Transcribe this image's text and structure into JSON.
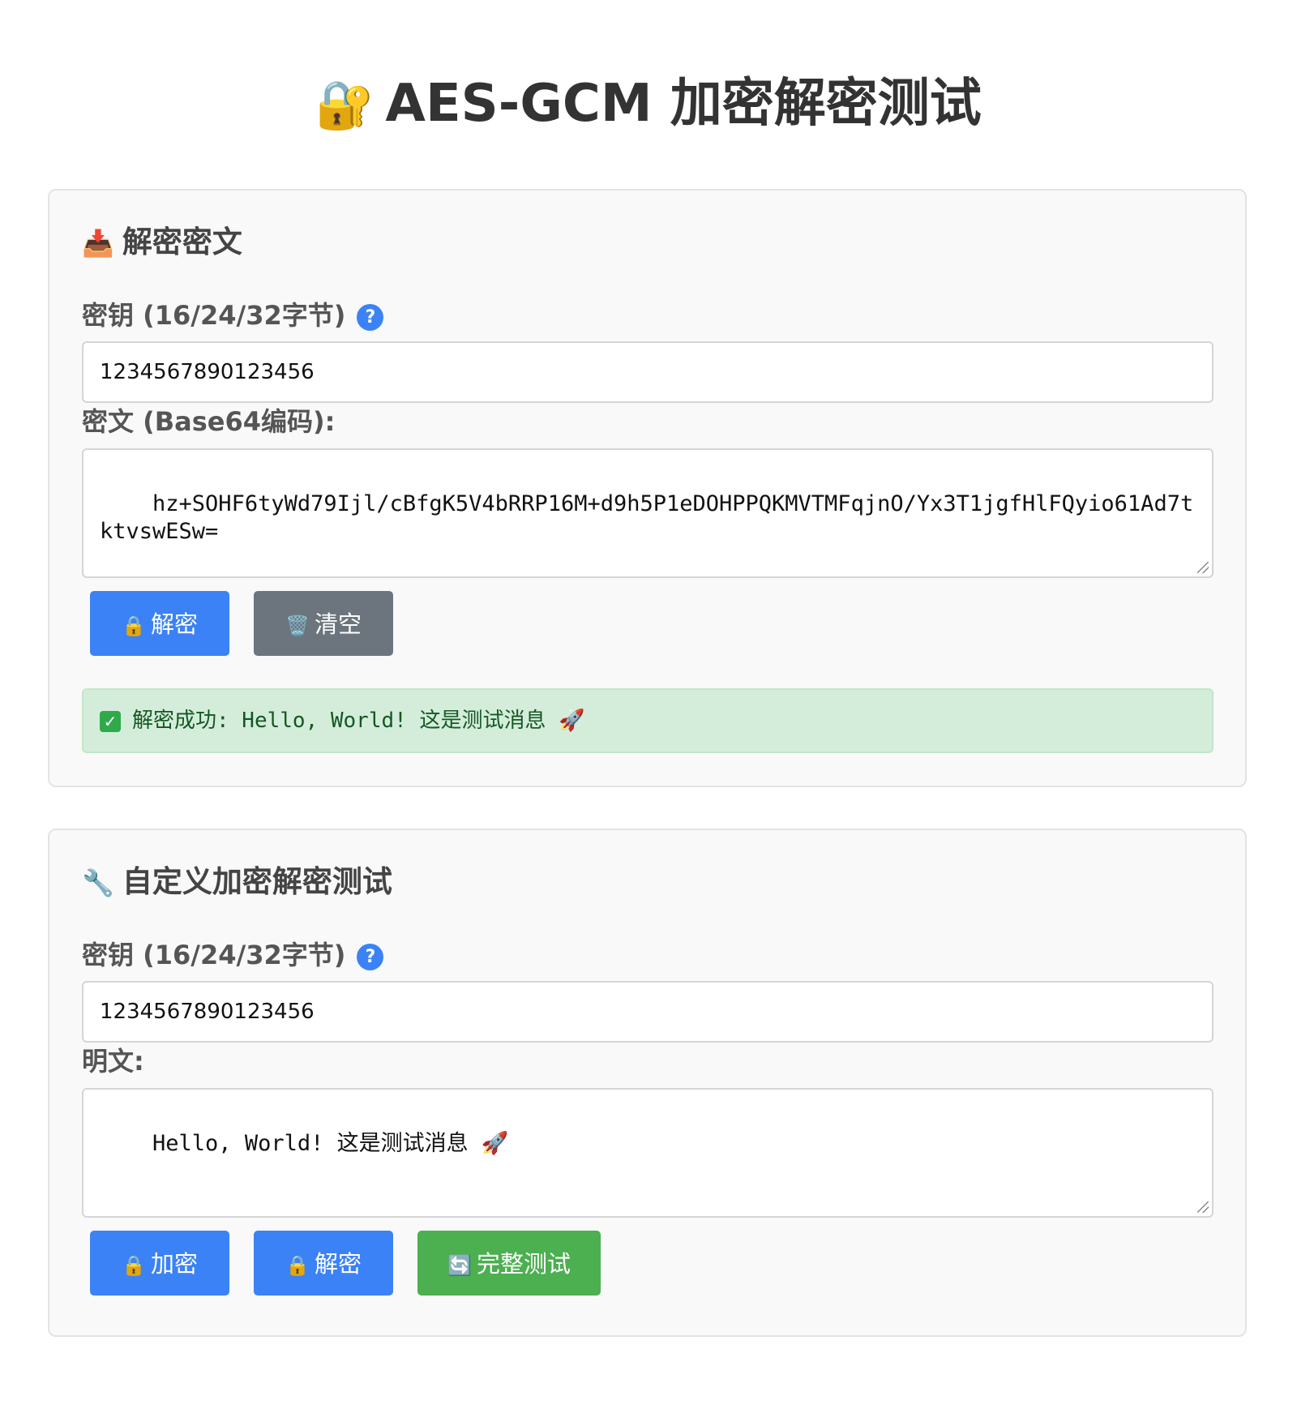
{
  "page": {
    "title_icon": "🔐",
    "title": "AES-GCM 加密解密测试"
  },
  "decrypt_section": {
    "icon": "📥",
    "title": "解密密文",
    "key_label": "密钥 (16/24/32字节)",
    "help_icon": "?",
    "key_value": "1234567890123456",
    "ciphertext_label": "密文 (Base64编码):",
    "ciphertext_value": "hz+SOHF6tyWd79Ijl/cBfgK5V4bRRP16M+d9h5P1eDOHPPQKMVTMFqjnO/Yx3T1jgfHlFQyio61Ad7tktvswESw=",
    "decrypt_button": {
      "icon": "🔒",
      "label": "解密"
    },
    "clear_button": {
      "icon": "🗑️",
      "label": "清空"
    },
    "result": {
      "icon": "✓",
      "text": "解密成功: Hello, World! 这是测试消息 🚀"
    }
  },
  "custom_section": {
    "icon": "🔧",
    "title": "自定义加密解密测试",
    "key_label": "密钥 (16/24/32字节)",
    "help_icon": "?",
    "key_value": "1234567890123456",
    "plaintext_label": "明文:",
    "plaintext_value": "Hello, World! 这是测试消息 🚀",
    "encrypt_button": {
      "icon": "🔒",
      "label": "加密"
    },
    "decrypt_button": {
      "icon": "🔒",
      "label": "解密"
    },
    "full_test_button": {
      "icon": "🔄",
      "label": "完整测试"
    }
  },
  "colors": {
    "primary_button": "#3b82f6",
    "secondary_button": "#6c757d",
    "success_button": "#4caf50",
    "success_background": "#d4edda",
    "success_text": "#155724"
  }
}
